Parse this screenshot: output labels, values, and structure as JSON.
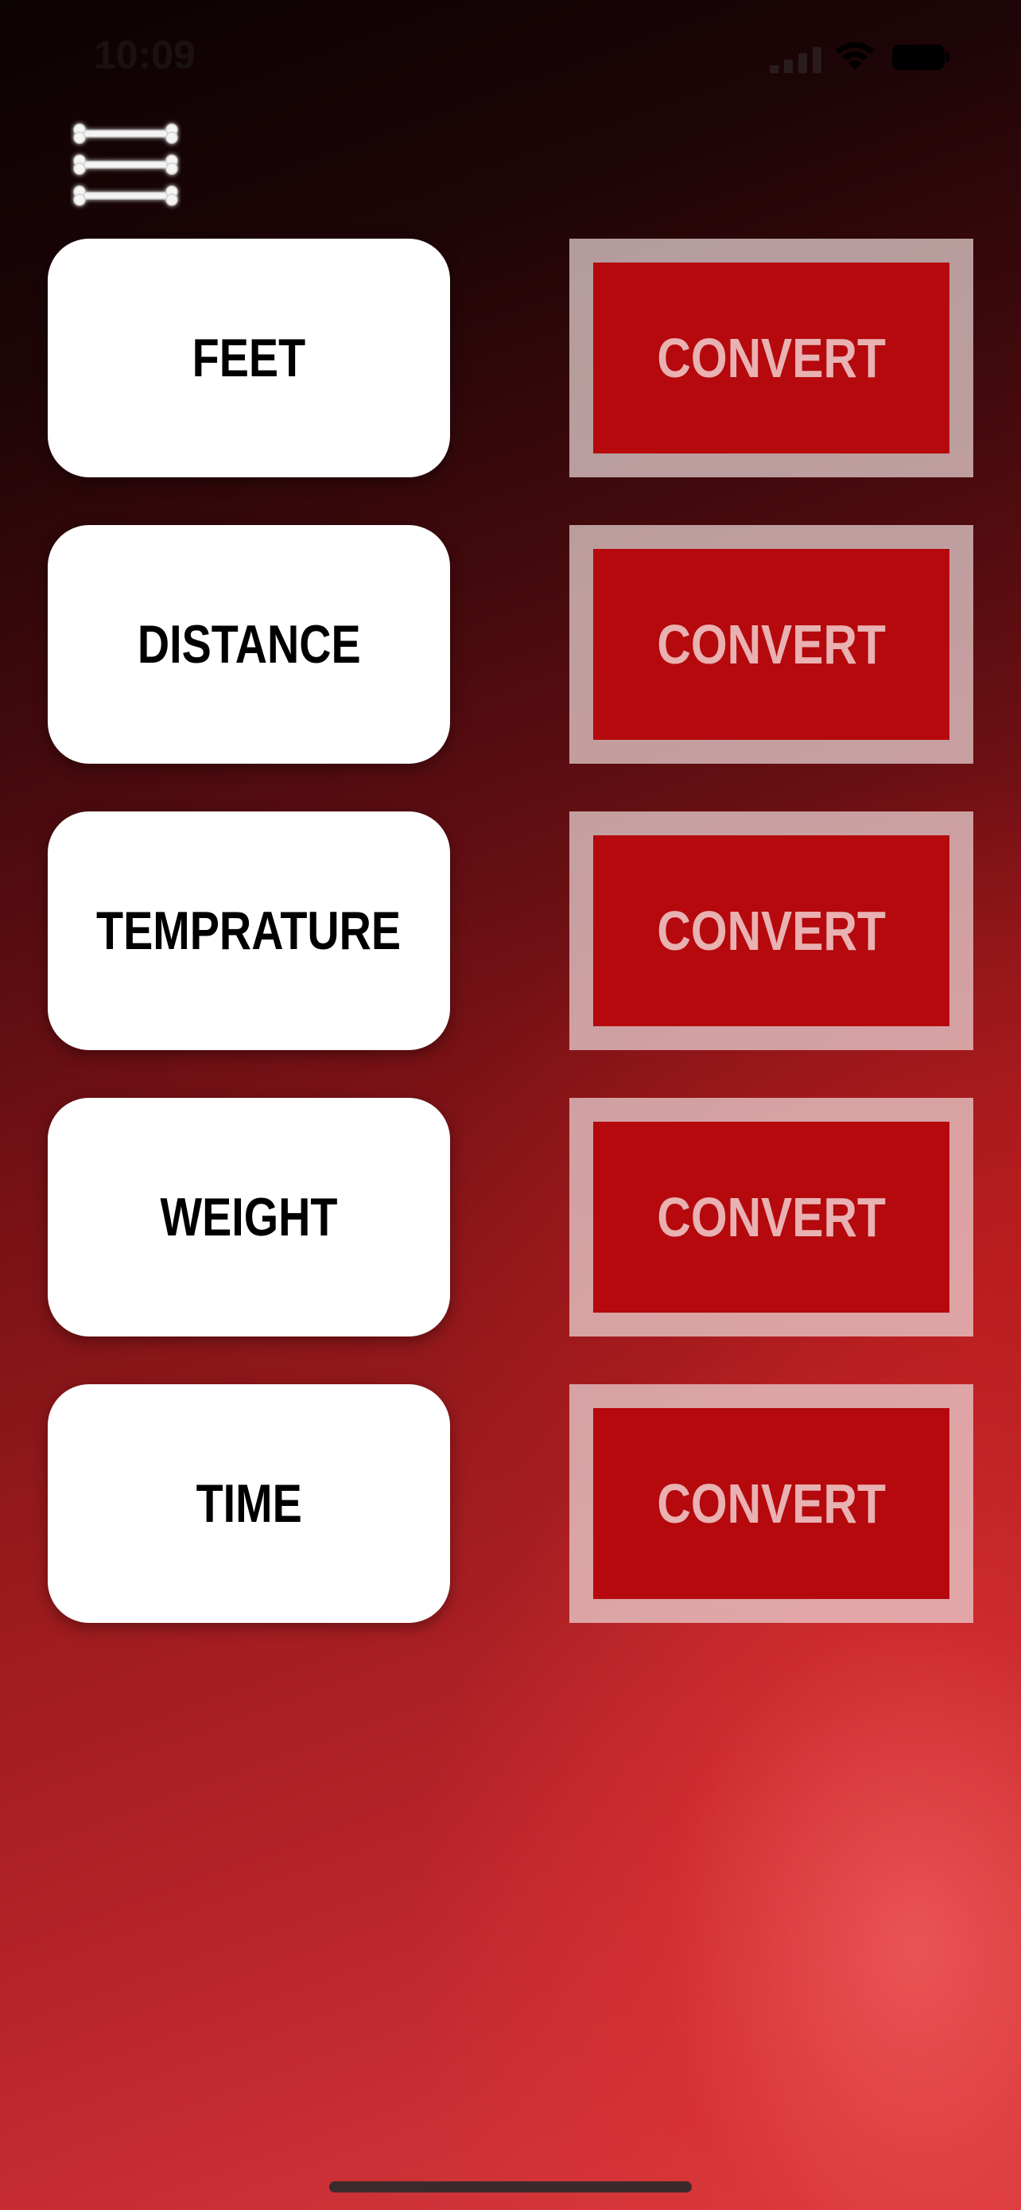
{
  "status_bar": {
    "time": "10:09",
    "signal_icon": "cellular-signal-icon",
    "wifi_icon": "wifi-icon",
    "battery_icon": "battery-icon"
  },
  "menu": {
    "icon": "hamburger-bone-icon"
  },
  "converters": [
    {
      "unit": "FEET",
      "action": "CONVERT"
    },
    {
      "unit": "DISTANCE",
      "action": "CONVERT"
    },
    {
      "unit": "TEMPRATURE",
      "action": "CONVERT"
    },
    {
      "unit": "WEIGHT",
      "action": "CONVERT"
    },
    {
      "unit": "TIME",
      "action": "CONVERT"
    }
  ],
  "colors": {
    "convert_fill": "#b5090d",
    "convert_border": "#ebd7d7",
    "unit_button_bg": "#ffffff",
    "background_dark": "#0b0203",
    "background_light": "#d94346"
  }
}
